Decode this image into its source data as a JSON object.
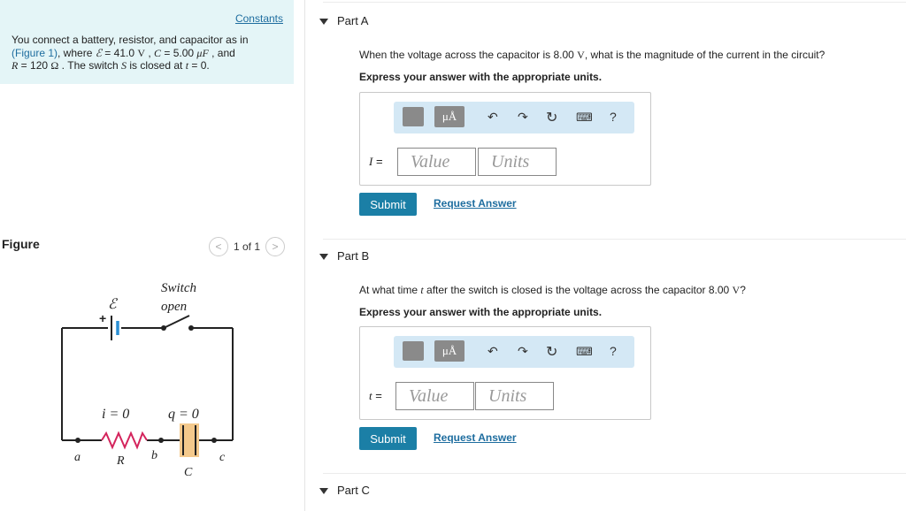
{
  "left": {
    "constants_link": "Constants",
    "problem": {
      "t1": "You connect a battery, resistor, and capacitor as in",
      "fig_link": "(Figure 1)",
      "t2": ", where ",
      "emf_sym": "ℰ",
      "t3": " = 41.0 ",
      "unit_v": "V",
      "t4": " , ",
      "c_sym": "C",
      "t5": " = 5.00 ",
      "unit_uf": "μF",
      "t6": " , and",
      "r_sym": "R",
      "t7": " = 120 ",
      "unit_ohm": "Ω",
      "t8": " . The switch ",
      "s_sym": "S",
      "t9": " is closed at ",
      "t_sym": "t",
      "t10": " = 0."
    },
    "figure_label": "Figure",
    "pager": {
      "prev": "<",
      "text": "1 of 1",
      "next": ">"
    },
    "circuit": {
      "emf": "ℰ",
      "plus": "+",
      "switch_label": "Switch",
      "open_label": "open",
      "i_label": "i = 0",
      "q_label": "q = 0",
      "a": "a",
      "b": "b",
      "c": "c",
      "R": "R",
      "C": "C"
    }
  },
  "parts": [
    {
      "title": "Part A",
      "question_pre": "When the voltage across the capacitor is 8.00 ",
      "question_unit": "V",
      "question_post": ", what is the magnitude of the current in the circuit?",
      "express": "Express your answer with the appropriate units.",
      "var": "I",
      "var_eq": " =",
      "value_placeholder": "Value",
      "units_placeholder": "Units",
      "unit_button": "μÅ",
      "help": "?",
      "submit": "Submit",
      "request": "Request Answer"
    },
    {
      "title": "Part B",
      "question_pre": "At what time ",
      "question_t": "t",
      "question_mid": " after the switch is closed is the voltage across the capacitor 8.00 ",
      "question_unit": "V",
      "question_post": "?",
      "express": "Express your answer with the appropriate units.",
      "var": "t",
      "var_eq": " =",
      "value_placeholder": "Value",
      "units_placeholder": "Units",
      "unit_button": "μÅ",
      "help": "?",
      "submit": "Submit",
      "request": "Request Answer"
    },
    {
      "title": "Part C"
    }
  ]
}
